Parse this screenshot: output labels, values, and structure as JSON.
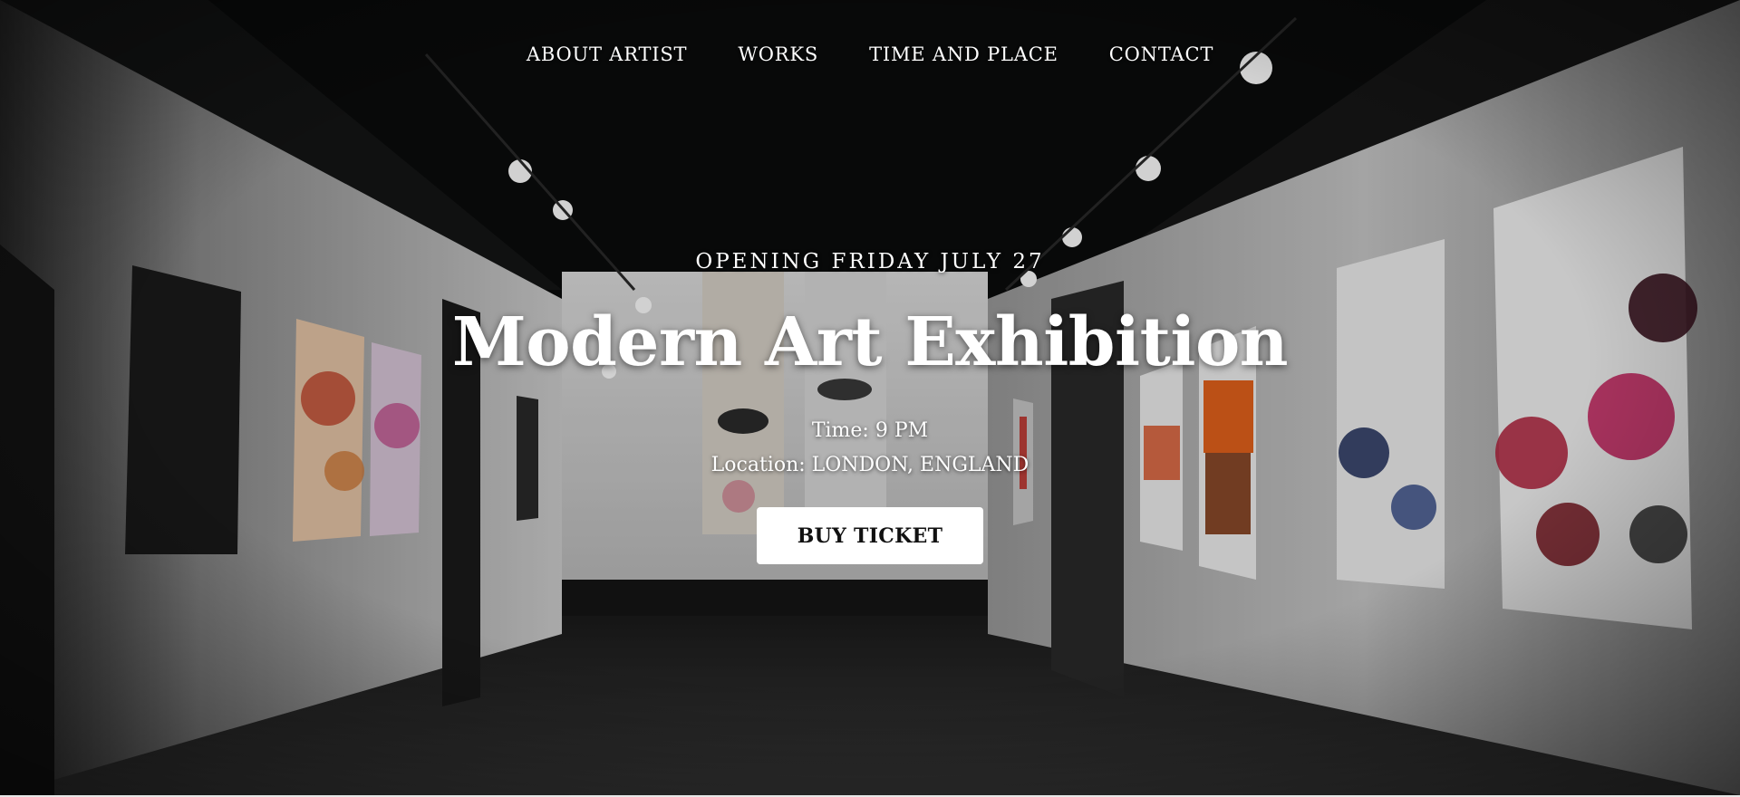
{
  "nav": {
    "items": [
      {
        "label": "ABOUT ARTIST"
      },
      {
        "label": "WORKS"
      },
      {
        "label": "TIME AND PLACE"
      },
      {
        "label": "CONTACT"
      }
    ]
  },
  "hero": {
    "opening": "OPENING FRIDAY JULY 27",
    "title": "Modern Art Exhibition",
    "time": "Time: 9 PM",
    "location": "Location: LONDON, ENGLAND",
    "cta_label": "BUY TICKET"
  }
}
